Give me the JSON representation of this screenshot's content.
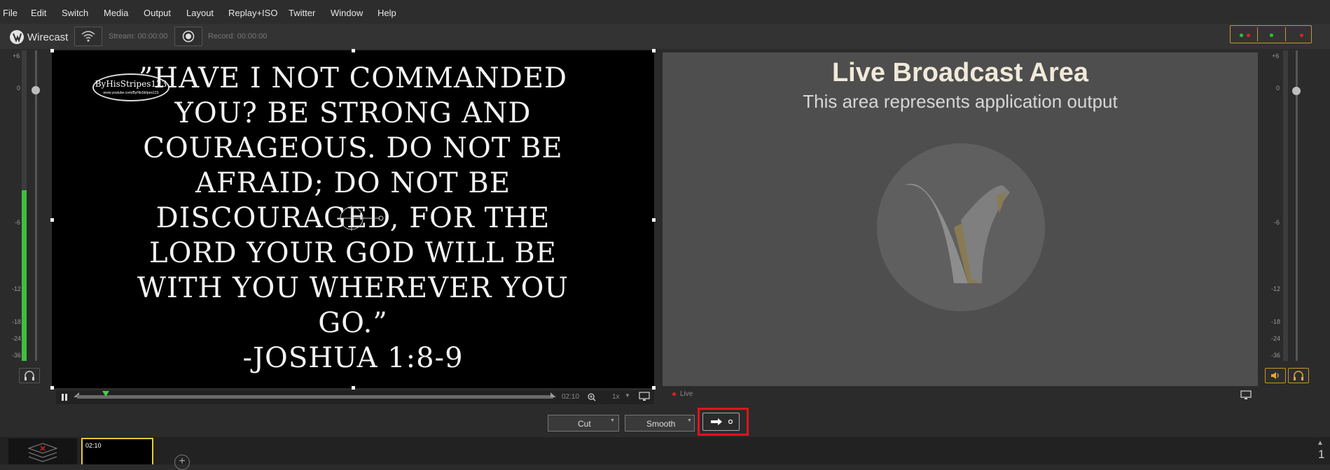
{
  "menu": [
    "File",
    "Edit",
    "Switch",
    "Media",
    "Output",
    "Layout",
    "Replay+ISO",
    "Twitter",
    "Window",
    "Help"
  ],
  "toolbar": {
    "app_name": "Wirecast",
    "stream_label": "Stream: 00:00:00",
    "record_label": "Record: 00:00:00",
    "status_dot_colors": [
      "#28c828",
      "#e02020",
      "#28c828",
      "#e02020"
    ]
  },
  "meters": {
    "left_scale": [
      "+6",
      "0",
      "-6",
      "-12",
      "-18",
      "-24",
      "-36"
    ],
    "right_scale": [
      "+6",
      "0",
      "-6",
      "-12",
      "-18",
      "-24",
      "-36"
    ],
    "left_level_fraction": 0.55
  },
  "preview": {
    "verse": "”HAVE I NOT COMMANDED YOU? BE STRONG AND COURAGEOUS. DO NOT BE AFRAID; DO NOT BE DISCOURAGED, FOR THE LORD YOUR GOD WILL BE WITH YOU WHEREVER YOU GO.”",
    "reference": "-JOSHUA 1:8-9",
    "logo_text": "ByHisStripes123",
    "logo_url": "www.youtube.com/ByHisStripes123",
    "duration": "02:10",
    "speed": "1x",
    "playhead_fraction": 0.06
  },
  "live": {
    "title": "Live Broadcast Area",
    "subtitle": "This area represents application output",
    "live_label": "Live"
  },
  "transition": {
    "first": "Cut",
    "second": "Smooth",
    "highlight_color": "#e0141e"
  },
  "shots": {
    "shot2_duration": "02:10"
  },
  "right_edge_digit": "1"
}
